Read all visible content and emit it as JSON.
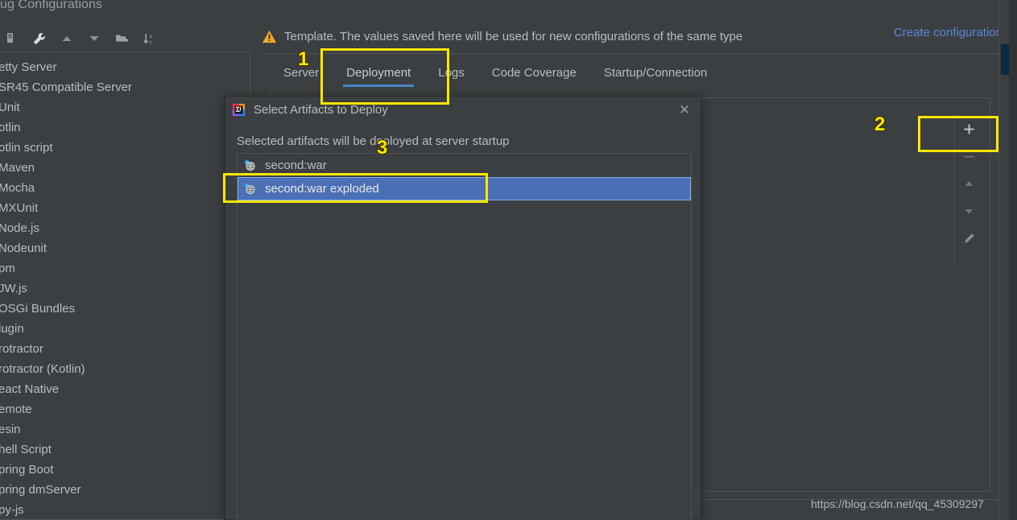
{
  "window": {
    "title": "ug Configurations",
    "close_label": "✕"
  },
  "toolbar": {
    "icons": [
      {
        "name": "copy-icon",
        "label": "copy"
      },
      {
        "name": "wrench-icon",
        "label": "edit-templates"
      },
      {
        "name": "arrow-up-icon",
        "label": "move-up"
      },
      {
        "name": "arrow-down-icon",
        "label": "move-down"
      },
      {
        "name": "new-folder-icon",
        "label": "new-folder"
      },
      {
        "name": "sort-az-icon",
        "label": "sort-alphabetically"
      }
    ]
  },
  "sidebar": {
    "items": [
      {
        "label": "etty Server"
      },
      {
        "label": "SR45 Compatible Server"
      },
      {
        "label": "Unit"
      },
      {
        "label": "otlin"
      },
      {
        "label": "otlin script"
      },
      {
        "label": "Maven"
      },
      {
        "label": "Mocha"
      },
      {
        "label": "MXUnit"
      },
      {
        "label": "Node.js"
      },
      {
        "label": "Nodeunit"
      },
      {
        "label": "pm"
      },
      {
        "label": "JW.js"
      },
      {
        "label": "OSGi Bundles"
      },
      {
        "label": "lugin"
      },
      {
        "label": "rotractor"
      },
      {
        "label": "rotractor (Kotlin)"
      },
      {
        "label": "eact Native"
      },
      {
        "label": "emote"
      },
      {
        "label": "esin"
      },
      {
        "label": "hell Script"
      },
      {
        "label": "pring Boot"
      },
      {
        "label": "pring dmServer"
      },
      {
        "label": "py-js"
      }
    ]
  },
  "banner": {
    "warning_icon": "warning-triangle-icon",
    "text": "Template. The values saved here will be used for new configurations of the same type",
    "create_configuration": "Create configuration"
  },
  "tabs": [
    {
      "label": "Server",
      "active": false
    },
    {
      "label": "Deployment",
      "active": true
    },
    {
      "label": "Logs",
      "active": false
    },
    {
      "label": "Code Coverage",
      "active": false
    },
    {
      "label": "Startup/Connection",
      "active": false
    }
  ],
  "side_actions": [
    {
      "name": "add-button",
      "glyph": "+"
    },
    {
      "name": "remove-button",
      "glyph": "−"
    },
    {
      "name": "move-up-button",
      "glyph": "▲"
    },
    {
      "name": "move-down-button",
      "glyph": "▼"
    },
    {
      "name": "edit-button",
      "glyph": "✎"
    }
  ],
  "dialog": {
    "app_icon": "intellij-idea-icon",
    "title": "Select Artifacts to Deploy",
    "close_label": "✕",
    "hint": "Selected artifacts will be deployed at server startup",
    "artifacts": [
      {
        "label": "second:war",
        "selected": false,
        "icon": "artifact-war-icon"
      },
      {
        "label": "second:war exploded",
        "selected": true,
        "icon": "artifact-war-exploded-icon"
      }
    ]
  },
  "annotations": [
    {
      "number": "1"
    },
    {
      "number": "2"
    },
    {
      "number": "3"
    }
  ],
  "watermark": "https://blog.csdn.net/qq_45309297",
  "colors": {
    "background": "#3c3f41",
    "panel_border": "#4e5254",
    "text": "#b9bcbe",
    "link": "#5a87d6",
    "tab_underline": "#4a88c7",
    "selection": "#4a6fb5",
    "selection_border": "#7bb3ee",
    "annotation": "#ffe700",
    "warning": "#f0a732"
  }
}
